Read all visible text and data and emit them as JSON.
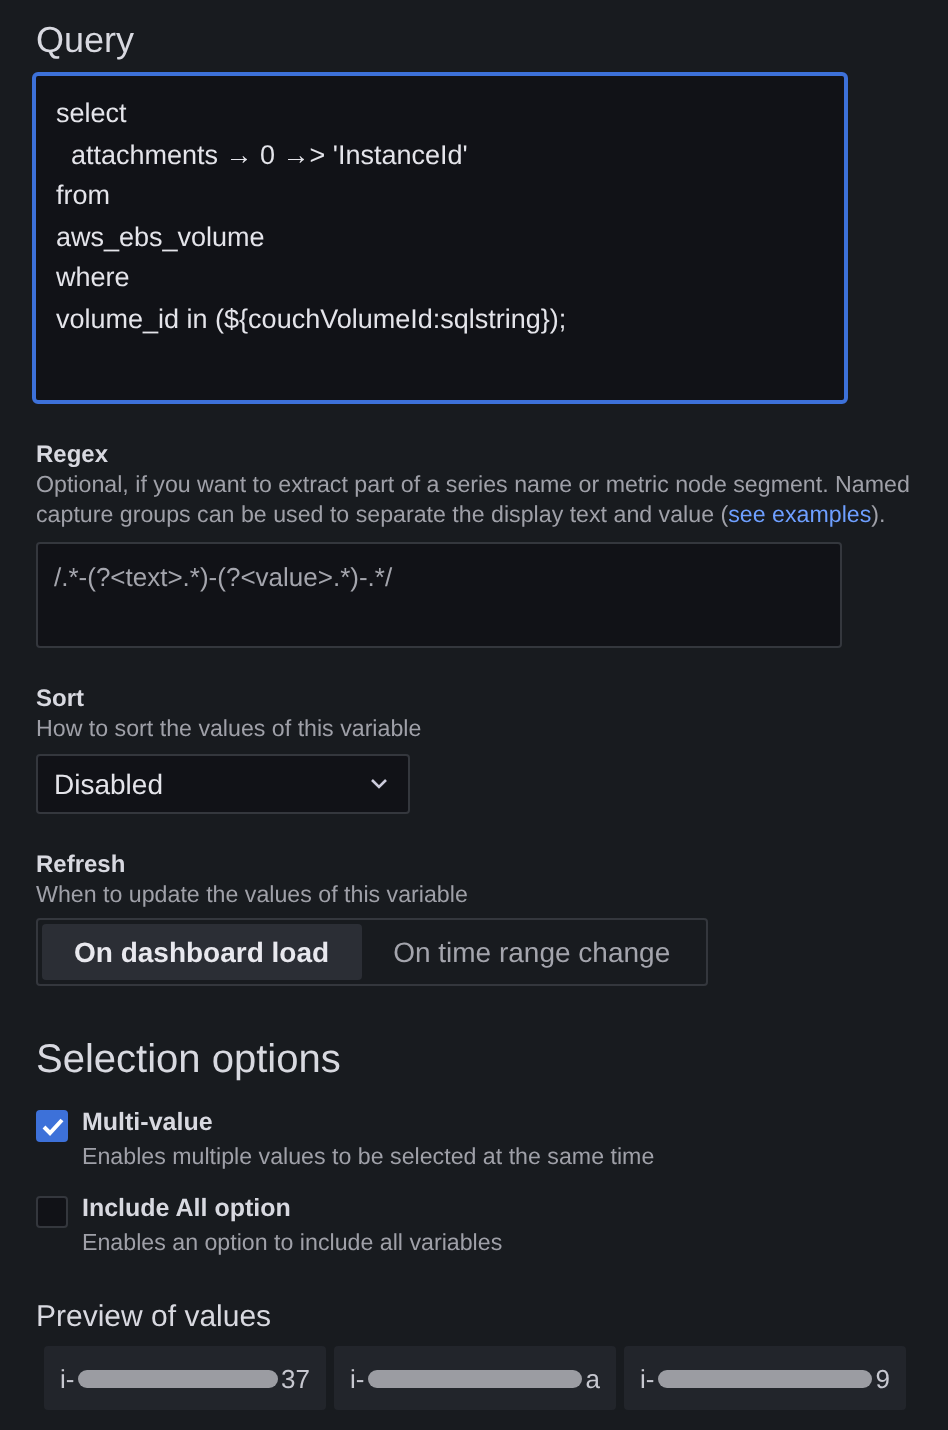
{
  "query": {
    "title": "Query",
    "lines": [
      "select",
      "  attachments → 0 →> 'InstanceId'",
      "from",
      "aws_ebs_volume",
      "where",
      "volume_id in (${couchVolumeId:sqlstring});"
    ],
    "focused": true
  },
  "regex": {
    "label": "Regex",
    "description": "Optional, if you want to extract part of a series name or metric node segment. Named capture groups can be used to separate the display text and value (",
    "link": "see examples",
    "description_end": ").",
    "value": "/.*-(?<text>.*)-(?<value>.*)-.*/"
  },
  "sort": {
    "label": "Sort",
    "description": "How to sort the values of this variable",
    "value": "Disabled"
  },
  "refresh": {
    "label": "Refresh",
    "description": "When to update the values of this variable",
    "options": [
      {
        "label": "On dashboard load",
        "selected": true
      },
      {
        "label": "On time range change",
        "selected": false
      }
    ]
  },
  "selection_options": {
    "title": "Selection options",
    "options": [
      {
        "label": "Multi-value",
        "description": "Enables multiple values to be selected at the same time",
        "checked": true
      },
      {
        "label": "Include All option",
        "description": "Enables an option to include all variables",
        "checked": false
      }
    ]
  },
  "preview": {
    "title": "Preview of values",
    "values": [
      {
        "prefix": "i-",
        "suffix": "37"
      },
      {
        "prefix": "i-",
        "suffix": "a"
      },
      {
        "prefix": "i-",
        "suffix": "9"
      }
    ]
  }
}
